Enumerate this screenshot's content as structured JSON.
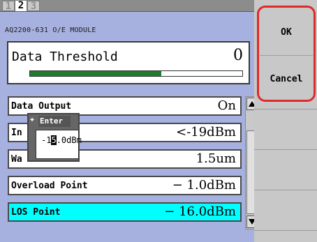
{
  "tabs": [
    "1",
    "2",
    "3"
  ],
  "active_tab_index": 1,
  "module_title": "AQ2200-631 O/E MODULE",
  "threshold": {
    "label": "Data Threshold",
    "value": "0",
    "level_percent": 62,
    "bar_color": "#1f7c2f"
  },
  "settings": [
    {
      "label": "Data Output",
      "value": "On",
      "selected": false
    },
    {
      "label": "In",
      "value": "<-19dBm",
      "selected": false
    },
    {
      "label": "Wa",
      "value": "1.5um",
      "selected": false
    },
    {
      "label": "Overload Point",
      "value": "− 1.0dBm",
      "selected": false
    },
    {
      "label": "LOS Point",
      "value": "− 16.0dBm",
      "selected": true
    }
  ],
  "enter_popup": {
    "title": "Enter",
    "value_prefix": "-1",
    "value_cursor": "5",
    "value_suffix": ".0dBm"
  },
  "buttons": {
    "ok_label": "OK",
    "cancel_label": "Cancel"
  },
  "colors": {
    "screen_bg": "#a7b1df",
    "selected_row": "#00ffff",
    "panel_bg": "#c8c8c8",
    "highlight_frame": "#e02a2a"
  }
}
